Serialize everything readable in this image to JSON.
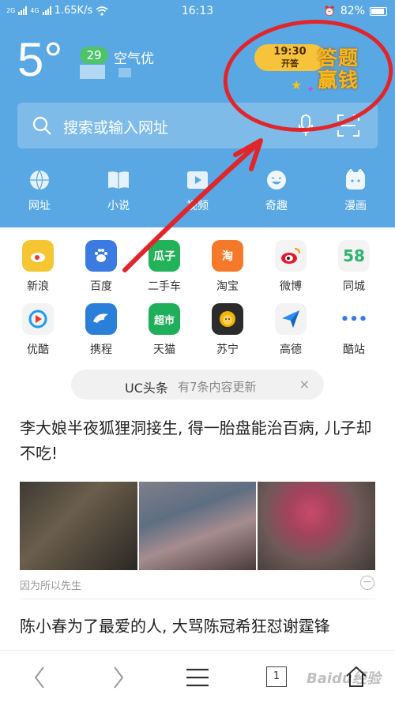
{
  "status_bar": {
    "sim1": "2G",
    "sim2": "4G",
    "network_speed": "1.65K/s",
    "time": "16:13",
    "battery": "82%"
  },
  "weather": {
    "temperature": "5°",
    "aqi_value": "29",
    "aqi_label": "空气优"
  },
  "promo": {
    "time": "19:30",
    "status": "开答",
    "title_line1": "答题",
    "title_line2": "赢钱"
  },
  "search": {
    "placeholder": "搜索或输入网址"
  },
  "nav": [
    {
      "label": "网址",
      "icon": "globe-icon"
    },
    {
      "label": "小说",
      "icon": "book-icon"
    },
    {
      "label": "视频",
      "icon": "play-icon"
    },
    {
      "label": "奇趣",
      "icon": "smile-icon"
    },
    {
      "label": "漫画",
      "icon": "comic-icon"
    }
  ],
  "apps": [
    {
      "label": "新浪",
      "color": "#f6c532"
    },
    {
      "label": "百度",
      "color": "#3b7ae0"
    },
    {
      "label": "二手车",
      "color": "#22b25a",
      "glyph": "瓜子"
    },
    {
      "label": "淘宝",
      "color": "#f5792a",
      "glyph": "淘"
    },
    {
      "label": "微博",
      "color": "#f3f3f3"
    },
    {
      "label": "同城",
      "color": "#f3f3f3",
      "glyph": "58"
    },
    {
      "label": "优酷",
      "color": "#f3f3f3"
    },
    {
      "label": "携程",
      "color": "#2a7fd8"
    },
    {
      "label": "天猫",
      "color": "#1fae5a",
      "glyph": "超市"
    },
    {
      "label": "苏宁",
      "color": "#2b2b2b"
    },
    {
      "label": "高德",
      "color": "#f3f3f3"
    },
    {
      "label": "酷站",
      "color": "#ffffff",
      "glyph": "•••"
    }
  ],
  "uc_news": {
    "title": "UC头条",
    "subtitle": "有7条内容更新",
    "close": "×"
  },
  "articles": [
    {
      "title": "李大娘半夜狐狸洞接生, 得一胎盘能治百病, 儿子却不吃!",
      "source": "因为所以先生"
    },
    {
      "title": "陈小春为了最爱的人, 大骂陈冠希狂怼谢霆锋"
    }
  ],
  "bottom_bar": {
    "tab_count": "1"
  },
  "watermark": "Baidu经验",
  "colors": {
    "header_bg": "#5aa8e3",
    "annotation": "#e0262b"
  }
}
